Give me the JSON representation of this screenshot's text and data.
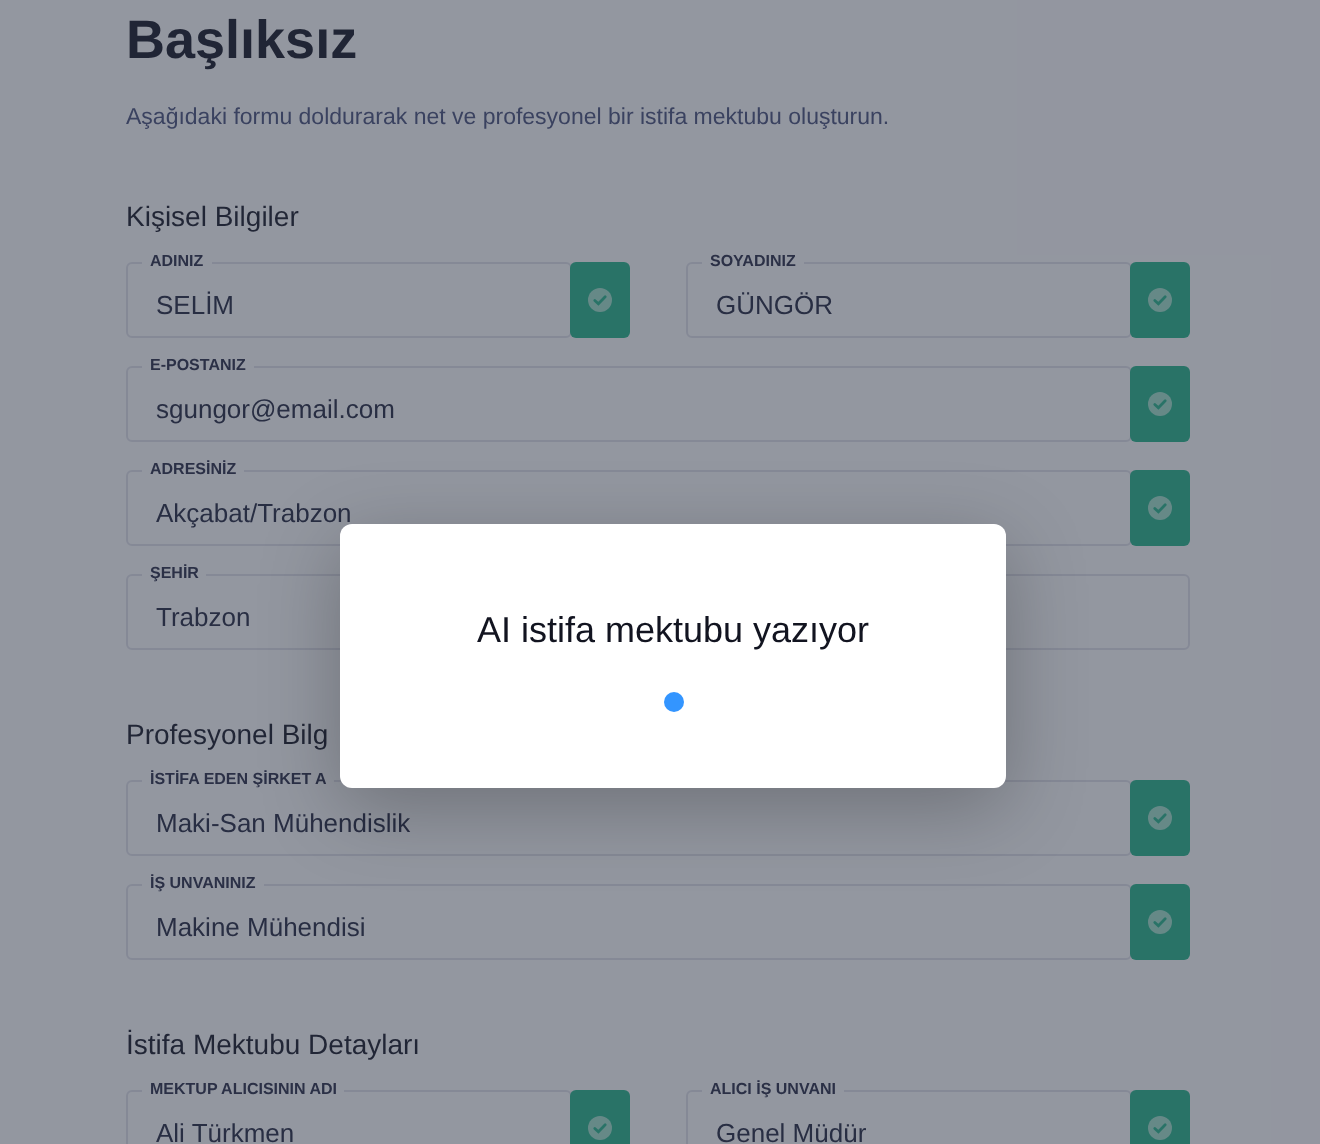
{
  "title": "Başlıksız",
  "subtitle": "Aşağıdaki formu doldurarak net ve profesyonel bir istifa mektubu oluşturun.",
  "sections": [
    {
      "title": "Kişisel Bilgiler",
      "rows": [
        [
          {
            "label": "ADINIZ",
            "value": "SELİM",
            "valid": true
          },
          {
            "label": "SOYADINIZ",
            "value": "GÜNGÖR",
            "valid": true
          }
        ],
        [
          {
            "label": "E-POSTANIZ",
            "value": "sgungor@email.com",
            "valid": true
          }
        ],
        [
          {
            "label": "ADRESİNİZ",
            "value": "Akçabat/Trabzon",
            "valid": true
          }
        ],
        [
          {
            "label": "ŞEHİR",
            "value": "Trabzon",
            "valid": false
          }
        ]
      ]
    },
    {
      "title": "Profesyonel Bilg",
      "rows": [
        [
          {
            "label": "İSTİFA EDEN ŞİRKET A",
            "value": "Maki-San Mühendislik",
            "valid": true
          }
        ],
        [
          {
            "label": "İŞ UNVANINIZ",
            "value": "Makine Mühendisi",
            "valid": true
          }
        ]
      ]
    },
    {
      "title": "İstifa Mektubu Detayları",
      "rows": [
        [
          {
            "label": "MEKTUP ALICISININ ADI",
            "value": "Ali Türkmen",
            "valid": true
          },
          {
            "label": "ALICI İŞ UNVANI",
            "value": "Genel Müdür",
            "valid": true
          }
        ]
      ]
    }
  ],
  "modal": {
    "title": "AI istifa mektubu yazıyor",
    "loading": true
  }
}
